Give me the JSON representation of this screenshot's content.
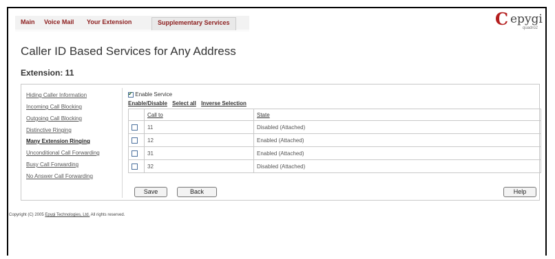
{
  "nav": {
    "tabs": [
      {
        "label": "Main"
      },
      {
        "label": "Voice Mail"
      },
      {
        "label": "Your Extension"
      },
      {
        "label": "Supplementary Services"
      }
    ]
  },
  "logo": {
    "brand": "epygi",
    "model": "quadro2"
  },
  "page": {
    "title": "Caller ID Based Services for Any Address",
    "subtitle": "Extension: 11"
  },
  "sidebar": {
    "items": [
      {
        "label": "Hiding Caller Information"
      },
      {
        "label": "Incoming Call Blocking"
      },
      {
        "label": "Outgoing Call Blocking"
      },
      {
        "label": "Distinctive Ringing"
      },
      {
        "label": "Many Extension Ringing"
      },
      {
        "label": "Unconditional Call Forwarding"
      },
      {
        "label": "Busy Call Forwarding"
      },
      {
        "label": "No Answer Call Forwarding"
      }
    ]
  },
  "enable_service": {
    "label": "Enable Service",
    "checked": true
  },
  "actions": {
    "enable_disable": "Enable/Disable",
    "select_all": "Select all",
    "inverse": "Inverse Selection"
  },
  "table": {
    "headers": [
      "Call to",
      "State"
    ],
    "rows": [
      {
        "call_to": "11",
        "state": "Disabled (Attached)"
      },
      {
        "call_to": "12",
        "state": "Enabled (Attached)"
      },
      {
        "call_to": "31",
        "state": "Enabled (Attached)"
      },
      {
        "call_to": "32",
        "state": "Disabled (Attached)"
      }
    ]
  },
  "buttons": {
    "save": "Save",
    "back": "Back",
    "help": "Help"
  },
  "footer": {
    "prefix": "Copyright (C) 2005",
    "company": "Epygi Technologies, Ltd.",
    "suffix": "All rights reserved."
  },
  "colors": {
    "nav_text": "#8b1c1c",
    "logo_red": "#b41e1e"
  }
}
